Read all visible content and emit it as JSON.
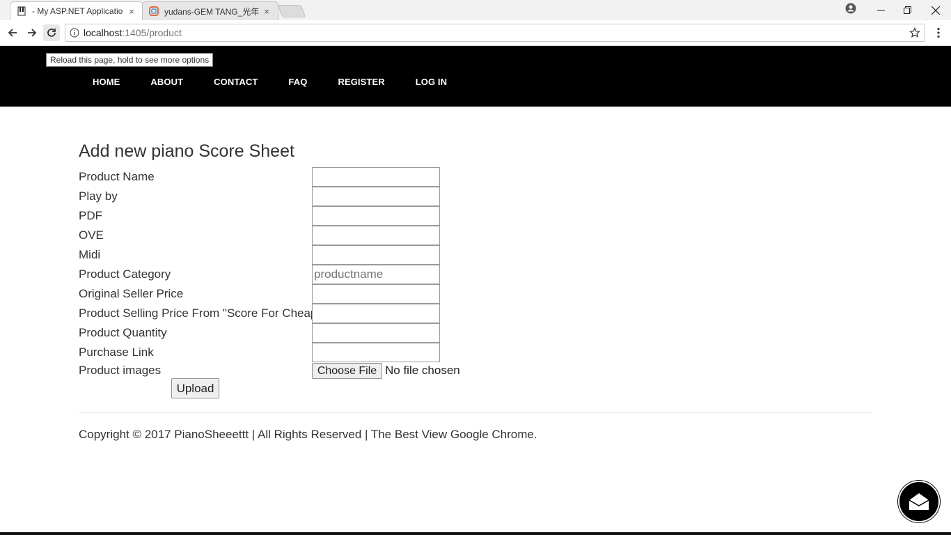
{
  "browser": {
    "tabs": [
      {
        "title": "- My ASP.NET Applicatio",
        "close": "×"
      },
      {
        "title": "yudans-GEM TANG_光年",
        "close": "×"
      }
    ],
    "url_host": "localhost",
    "url_path": ":1405/product",
    "tooltip": "Reload this page, hold to see more options"
  },
  "nav": {
    "links": [
      "HOME",
      "ABOUT",
      "CONTACT",
      "FAQ",
      "REGISTER",
      "LOG IN"
    ]
  },
  "form": {
    "title": "Add new piano Score Sheet",
    "fields": [
      {
        "label": "Product Name",
        "value": "",
        "placeholder": ""
      },
      {
        "label": "Play by",
        "value": "",
        "placeholder": ""
      },
      {
        "label": "PDF",
        "value": "",
        "placeholder": ""
      },
      {
        "label": "OVE",
        "value": "",
        "placeholder": ""
      },
      {
        "label": "Midi",
        "value": "",
        "placeholder": ""
      },
      {
        "label": "Product Category",
        "value": "",
        "placeholder": "productname"
      },
      {
        "label": "Original Seller Price",
        "value": "",
        "placeholder": ""
      },
      {
        "label": "Product Selling Price From \"Score For Cheap\"",
        "value": "",
        "placeholder": ""
      },
      {
        "label": "Product Quantity",
        "value": "",
        "placeholder": ""
      },
      {
        "label": "Purchase Link",
        "value": "",
        "placeholder": ""
      }
    ],
    "images_label": "Product images",
    "choose_file_label": "Choose File",
    "file_status": "No file chosen",
    "upload_label": "Upload"
  },
  "footer": {
    "text": "Copyright © 2017 PianoSheeettt | All Rights Reserved | The Best View Google Chrome."
  }
}
